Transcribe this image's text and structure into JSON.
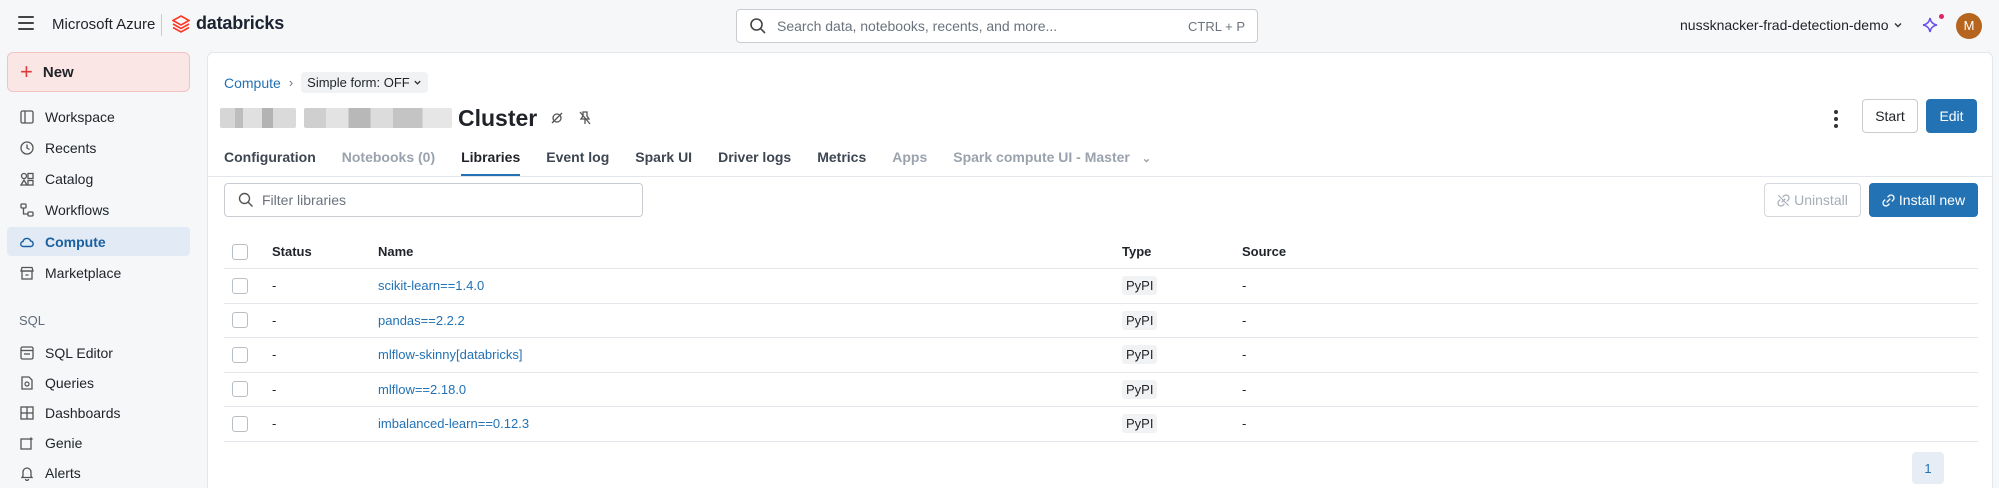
{
  "topbar": {
    "brand_ms": "Microsoft Azure",
    "brand_db": "databricks",
    "search_placeholder": "Search data, notebooks, recents, and more...",
    "search_shortcut": "CTRL + P",
    "workspace": "nussknacker-frad-detection-demo",
    "avatar_initial": "M"
  },
  "sidebar": {
    "new_label": "New",
    "items": [
      {
        "label": "Workspace",
        "icon": "workspace-icon"
      },
      {
        "label": "Recents",
        "icon": "clock-icon"
      },
      {
        "label": "Catalog",
        "icon": "catalog-icon"
      },
      {
        "label": "Workflows",
        "icon": "workflows-icon"
      },
      {
        "label": "Compute",
        "icon": "cloud-icon",
        "active": true
      },
      {
        "label": "Marketplace",
        "icon": "store-icon"
      }
    ],
    "sql_section": "SQL",
    "sql_items": [
      {
        "label": "SQL Editor",
        "icon": "sql-editor-icon"
      },
      {
        "label": "Queries",
        "icon": "queries-icon"
      },
      {
        "label": "Dashboards",
        "icon": "dashboards-icon"
      },
      {
        "label": "Genie",
        "icon": "genie-icon"
      },
      {
        "label": "Alerts",
        "icon": "bell-icon"
      }
    ]
  },
  "breadcrumb": {
    "compute": "Compute",
    "simple_form": "Simple form: OFF"
  },
  "cluster": {
    "title": "Cluster"
  },
  "actions": {
    "start": "Start",
    "edit": "Edit",
    "uninstall": "Uninstall",
    "install_new": "Install new"
  },
  "tabs": [
    {
      "label": "Configuration",
      "state": "normal"
    },
    {
      "label": "Notebooks (0)",
      "state": "muted"
    },
    {
      "label": "Libraries",
      "state": "active"
    },
    {
      "label": "Event log",
      "state": "normal"
    },
    {
      "label": "Spark UI",
      "state": "normal"
    },
    {
      "label": "Driver logs",
      "state": "normal"
    },
    {
      "label": "Metrics",
      "state": "normal"
    },
    {
      "label": "Apps",
      "state": "muted"
    },
    {
      "label": "Spark compute UI - Master",
      "state": "muted"
    }
  ],
  "filter": {
    "placeholder": "Filter libraries"
  },
  "table": {
    "headers": {
      "status": "Status",
      "name": "Name",
      "type": "Type",
      "source": "Source"
    },
    "rows": [
      {
        "status": "-",
        "name": "scikit-learn==1.4.0",
        "type": "PyPI",
        "source": "-"
      },
      {
        "status": "-",
        "name": "pandas==2.2.2",
        "type": "PyPI",
        "source": "-"
      },
      {
        "status": "-",
        "name": "mlflow-skinny[databricks]",
        "type": "PyPI",
        "source": "-"
      },
      {
        "status": "-",
        "name": "mlflow==2.18.0",
        "type": "PyPI",
        "source": "-"
      },
      {
        "status": "-",
        "name": "imbalanced-learn==0.12.3",
        "type": "PyPI",
        "source": "-"
      }
    ]
  },
  "pagination": {
    "current_page": "1"
  },
  "colors": {
    "accent": "#2272b4",
    "new_button_bg": "#fbe6e6",
    "active_nav_bg": "#e2ebf5"
  }
}
